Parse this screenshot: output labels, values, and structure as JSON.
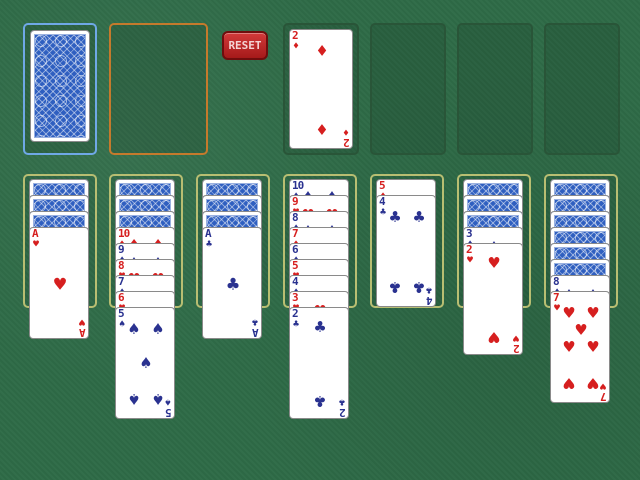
{
  "controls": {
    "reset_label": "RESET"
  },
  "colors": {
    "table": "#2e6b47",
    "red_suit": "#d61f1f",
    "black_suit": "#2a3290",
    "card_back": "#2f5fc0"
  },
  "stock": {
    "card_count": 1
  },
  "waste": {
    "cards": []
  },
  "foundations": [
    {
      "top": {
        "rank": "2",
        "suit": "diamond"
      }
    },
    {
      "top": null
    },
    {
      "top": null
    },
    {
      "top": null
    }
  ],
  "tableau": [
    {
      "face_down": 3,
      "face_up": [
        {
          "rank": "A",
          "suit": "heart"
        }
      ]
    },
    {
      "face_down": 3,
      "face_up": [
        {
          "rank": "10",
          "suit": "diamond"
        },
        {
          "rank": "9",
          "suit": "spade"
        },
        {
          "rank": "8",
          "suit": "heart"
        },
        {
          "rank": "7",
          "suit": "spade"
        },
        {
          "rank": "6",
          "suit": "heart"
        },
        {
          "rank": "5",
          "suit": "spade"
        }
      ]
    },
    {
      "face_down": 3,
      "face_up": [
        {
          "rank": "A",
          "suit": "club"
        }
      ]
    },
    {
      "face_down": 0,
      "face_up": [
        {
          "rank": "10",
          "suit": "spade"
        },
        {
          "rank": "9",
          "suit": "heart"
        },
        {
          "rank": "8",
          "suit": "spade"
        },
        {
          "rank": "7",
          "suit": "diamond"
        },
        {
          "rank": "6",
          "suit": "spade"
        },
        {
          "rank": "5",
          "suit": "heart"
        },
        {
          "rank": "4",
          "suit": "spade"
        },
        {
          "rank": "3",
          "suit": "heart"
        },
        {
          "rank": "2",
          "suit": "club"
        }
      ]
    },
    {
      "face_down": 0,
      "face_up": [
        {
          "rank": "5",
          "suit": "diamond"
        },
        {
          "rank": "4",
          "suit": "club"
        }
      ]
    },
    {
      "face_down": 3,
      "face_up": [
        {
          "rank": "3",
          "suit": "spade"
        },
        {
          "rank": "2",
          "suit": "heart"
        }
      ]
    },
    {
      "face_down": 6,
      "face_up": [
        {
          "rank": "8",
          "suit": "spade"
        },
        {
          "rank": "7",
          "suit": "heart"
        }
      ]
    }
  ]
}
